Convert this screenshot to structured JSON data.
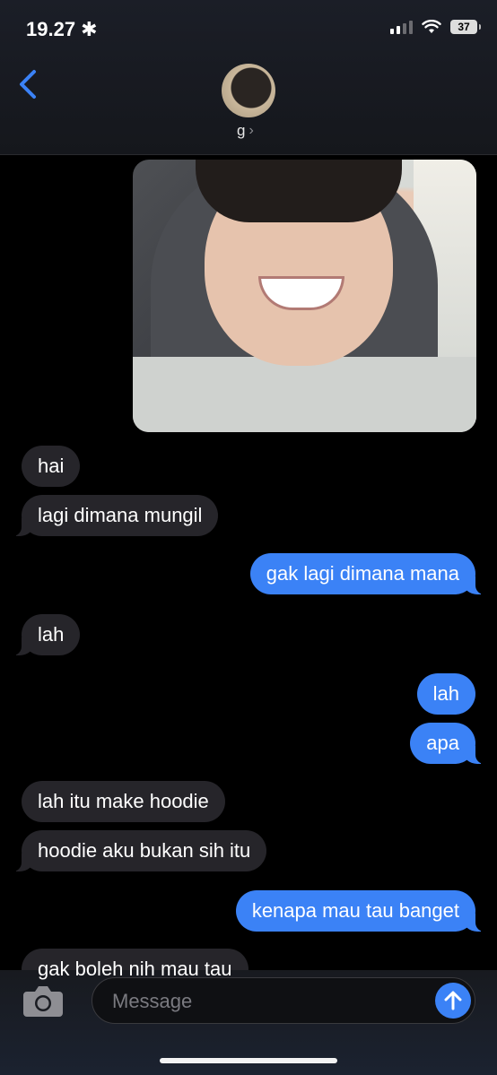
{
  "status": {
    "time": "19.27",
    "time_icon": "asterisk",
    "battery": "37"
  },
  "contact": {
    "name": "g",
    "chevron": "›"
  },
  "messages": [
    {
      "side": "in",
      "text": "hai"
    },
    {
      "side": "in",
      "text": "lagi dimana mungil"
    },
    {
      "side": "out",
      "text": "gak lagi dimana mana"
    },
    {
      "side": "in",
      "text": "lah"
    },
    {
      "side": "out",
      "text": "lah"
    },
    {
      "side": "out",
      "text": "apa"
    },
    {
      "side": "in",
      "text": "lah itu make hoodie"
    },
    {
      "side": "in",
      "text": "hoodie aku bukan sih itu"
    },
    {
      "side": "out",
      "text": "kenapa mau tau banget"
    },
    {
      "side": "in",
      "text": "gak boleh nih mau tau"
    }
  ],
  "composer": {
    "placeholder": "Message"
  },
  "colors": {
    "outgoing": "#3b82f6",
    "incoming": "#26252a",
    "accent": "#3b82f6"
  }
}
